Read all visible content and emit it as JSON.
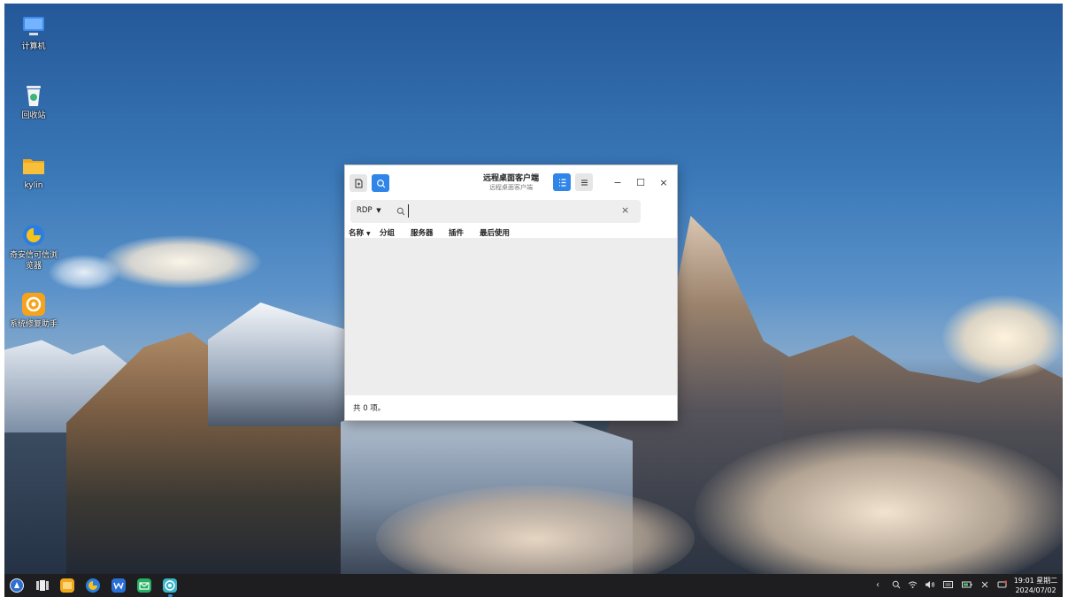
{
  "desktop_icons": [
    {
      "label": "计算机",
      "icon": "computer-icon"
    },
    {
      "label": "回收站",
      "icon": "trash-icon"
    },
    {
      "label": "kylin",
      "icon": "folder-icon"
    },
    {
      "label": "奇安信可信浏览器",
      "icon": "browser-icon"
    },
    {
      "label": "系统修复助手",
      "icon": "repair-icon"
    }
  ],
  "window": {
    "title": "远程桌面客户端",
    "subtitle": "远程桌面客户端",
    "toolbar_icons": [
      "new-connection-icon",
      "search-icon",
      "list-view-icon",
      "menu-icon"
    ],
    "controls": {
      "minimize": "−",
      "maximize": "☐",
      "close": "×"
    },
    "search": {
      "protocol": "RDP",
      "value": "",
      "clear": "×"
    },
    "columns": [
      "名称",
      "分组",
      "服务器",
      "插件",
      "最后使用"
    ],
    "status": "共 0 项。"
  },
  "taskbar": {
    "apps": [
      "start-menu-icon",
      "multitask-view-icon",
      "file-manager-icon",
      "browser-icon",
      "wps-icon",
      "mail-icon",
      "remote-desktop-icon"
    ],
    "tray_icons": [
      "chevron-left-icon",
      "search-icon",
      "wifi-icon",
      "volume-icon",
      "keyboard-icon",
      "battery-icon",
      "bluetooth-icon",
      "notification-icon"
    ],
    "time": "19:01 星期二",
    "date": "2024/07/02"
  },
  "colors": {
    "accent": "#2f85e8",
    "taskbar": "#1e1e21",
    "list_bg": "#ededed"
  }
}
